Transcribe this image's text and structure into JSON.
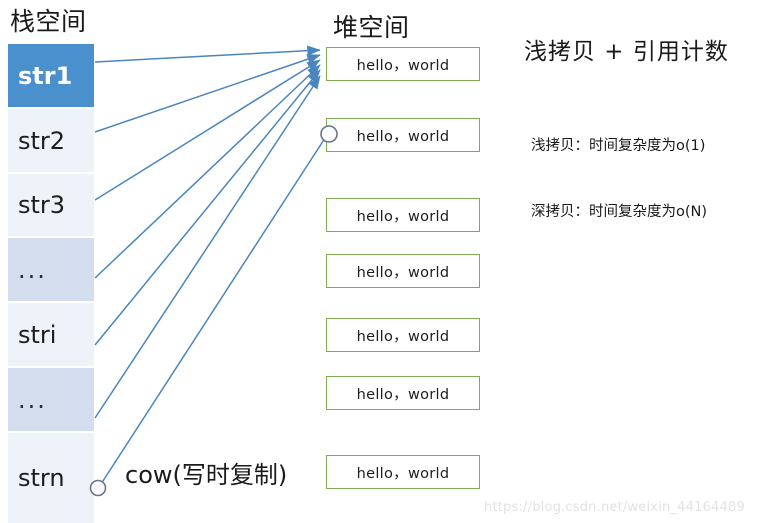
{
  "titles": {
    "stack": "栈空间",
    "heap": "堆空间"
  },
  "stack": {
    "cells": [
      {
        "label": "str1",
        "state": "selected"
      },
      {
        "label": "str2",
        "state": "normal"
      },
      {
        "label": "str3",
        "state": "normal"
      },
      {
        "label": "...",
        "state": "alt"
      },
      {
        "label": "stri",
        "state": "normal"
      },
      {
        "label": "...",
        "state": "alt"
      },
      {
        "label": "strn",
        "state": "normal"
      }
    ]
  },
  "heap": {
    "boxes": [
      {
        "text": "hello，world"
      },
      {
        "text": "hello，world"
      },
      {
        "text": "hello，world"
      },
      {
        "text": "hello，world"
      },
      {
        "text": "hello，world"
      },
      {
        "text": "hello，world"
      },
      {
        "text": "hello，world"
      }
    ]
  },
  "notes": {
    "main": "浅拷贝 + 引用计数",
    "shallow": "浅拷贝：时间复杂度为o(1)",
    "deep": "深拷贝：时间复杂度为o(N)"
  },
  "cow": {
    "label": "cow(写时复制)"
  },
  "watermark": "https://blog.csdn.net/weixin_44164489",
  "colors": {
    "selected_cell": "#4a90cc",
    "cell_light": "#eef2f9",
    "cell_dark": "#d3ddee",
    "heap_border": "#80ad53",
    "arrow": "#4a85be",
    "text": "#1a1a1a",
    "watermark": "#e2e2e2"
  }
}
